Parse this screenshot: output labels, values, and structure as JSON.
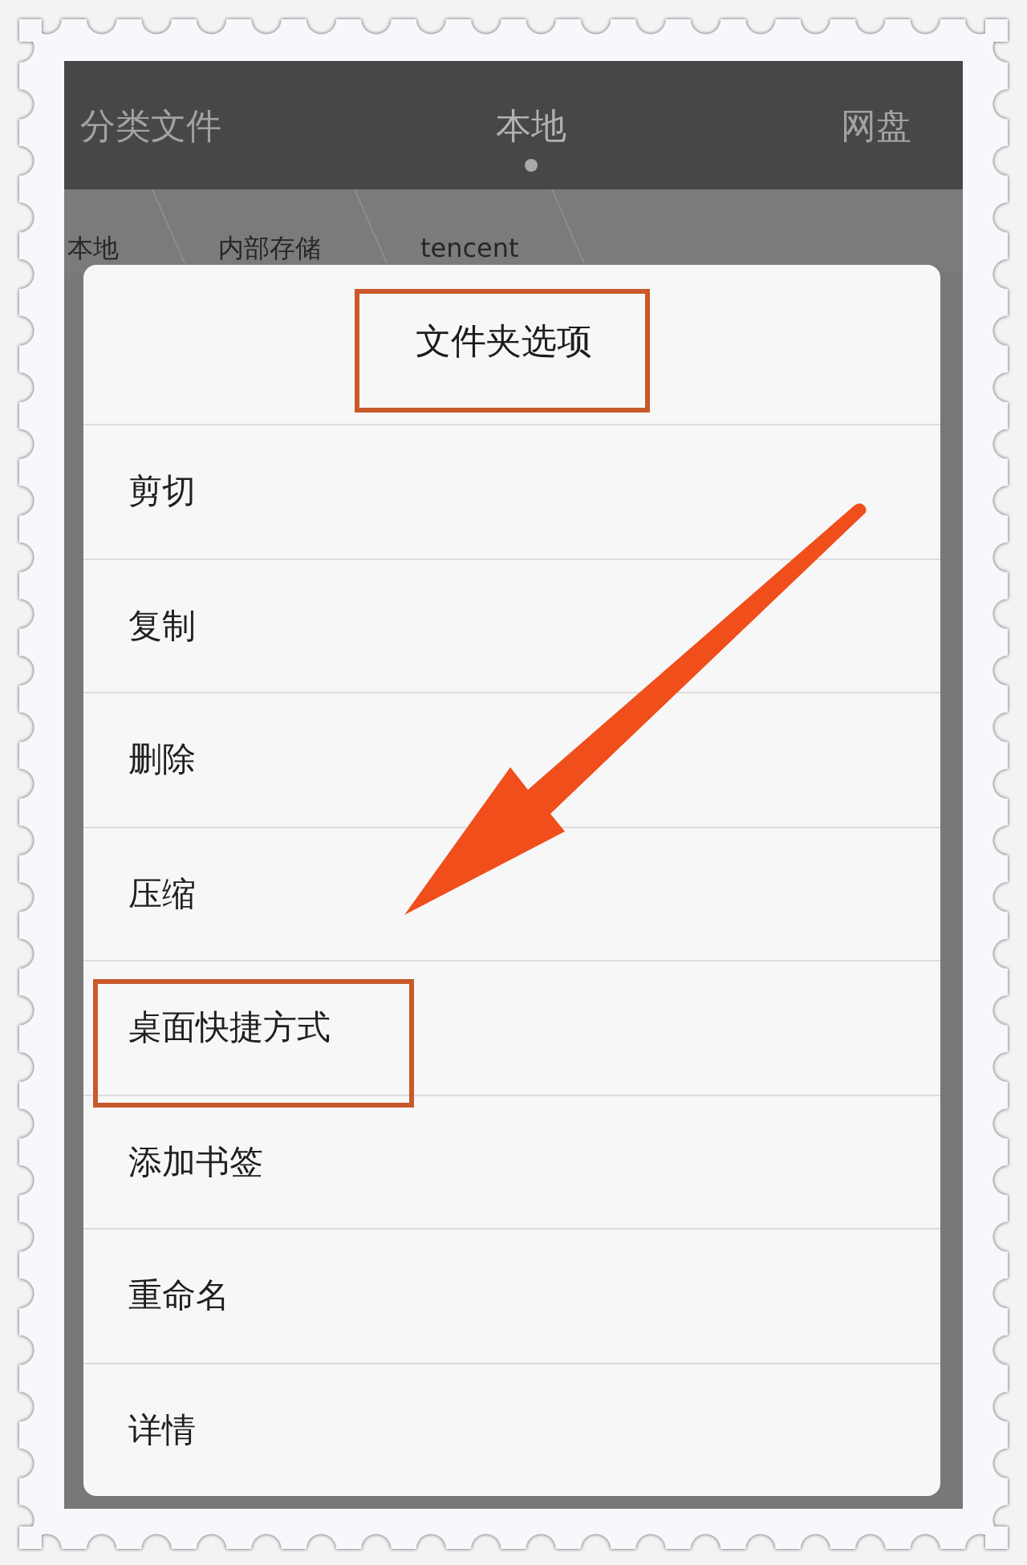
{
  "tabs": [
    {
      "label": "分类文件",
      "selected": false
    },
    {
      "label": "本地",
      "selected": true
    },
    {
      "label": "网盘",
      "selected": false
    }
  ],
  "breadcrumb": [
    "本地",
    "内部存储",
    "tencent"
  ],
  "dialog": {
    "title": {
      "text": "文件夹选项",
      "highlighted": true
    },
    "items": [
      {
        "label": "剪切",
        "highlighted": false
      },
      {
        "label": "复制",
        "highlighted": false
      },
      {
        "label": "删除",
        "highlighted": false
      },
      {
        "label": "压缩",
        "highlighted": false
      },
      {
        "label": "桌面快捷方式",
        "highlighted": true
      },
      {
        "label": "添加书签",
        "highlighted": false
      },
      {
        "label": "重命名",
        "highlighted": false
      },
      {
        "label": "详情",
        "highlighted": false
      }
    ]
  }
}
